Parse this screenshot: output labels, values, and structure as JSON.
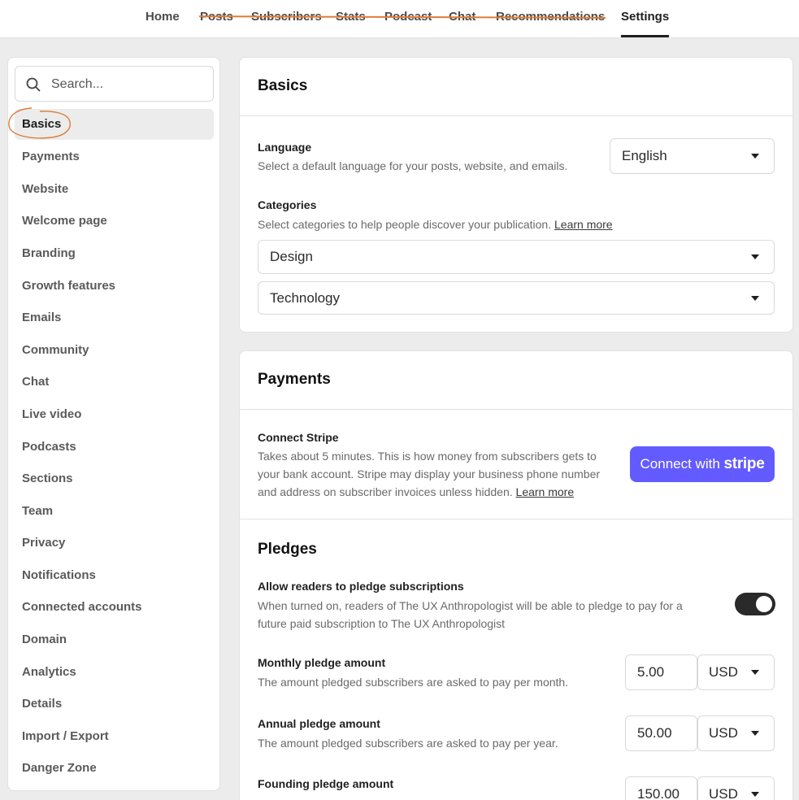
{
  "topnav": {
    "tabs": [
      {
        "label": "Home"
      },
      {
        "label": "Posts"
      },
      {
        "label": "Subscribers"
      },
      {
        "label": "Stats"
      },
      {
        "label": "Podcast"
      },
      {
        "label": "Chat"
      },
      {
        "label": "Recommendations"
      },
      {
        "label": "Settings"
      }
    ],
    "active": "Settings"
  },
  "sidebar": {
    "search_placeholder": "Search...",
    "items": [
      {
        "label": "Basics"
      },
      {
        "label": "Payments"
      },
      {
        "label": "Website"
      },
      {
        "label": "Welcome page"
      },
      {
        "label": "Branding"
      },
      {
        "label": "Growth features"
      },
      {
        "label": "Emails"
      },
      {
        "label": "Community"
      },
      {
        "label": "Chat"
      },
      {
        "label": "Live video"
      },
      {
        "label": "Podcasts"
      },
      {
        "label": "Sections"
      },
      {
        "label": "Team"
      },
      {
        "label": "Privacy"
      },
      {
        "label": "Notifications"
      },
      {
        "label": "Connected accounts"
      },
      {
        "label": "Domain"
      },
      {
        "label": "Analytics"
      },
      {
        "label": "Details"
      },
      {
        "label": "Import / Export"
      },
      {
        "label": "Danger Zone"
      }
    ]
  },
  "basics": {
    "title": "Basics",
    "language_label": "Language",
    "language_desc": "Select a default language for your posts, website, and emails.",
    "language_value": "English",
    "categories_label": "Categories",
    "categories_desc": "Select categories to help people discover your publication.",
    "learn_more": "Learn more",
    "category_1": "Design",
    "category_2": "Technology"
  },
  "payments": {
    "title": "Payments",
    "stripe_label": "Connect Stripe",
    "stripe_desc_1": "Takes about 5 minutes. This is how money from subscribers gets to",
    "stripe_desc_2": "your bank account. Stripe may display your business phone number",
    "stripe_desc_3": "and address on subscriber invoices unless hidden.",
    "learn_more": "Learn more",
    "stripe_button_prefix": "Connect with",
    "stripe_button_brand": "stripe",
    "pledges_title": "Pledges",
    "pledge_toggle_label": "Allow readers to pledge subscriptions",
    "pledge_toggle_desc_1": "When turned on, readers of The UX Anthropologist will be able to pledge to pay for a",
    "pledge_toggle_desc_2": "future paid subscription to The UX Anthropologist",
    "pledge_toggle_on": true,
    "monthly_label": "Monthly pledge amount",
    "monthly_desc": "The amount pledged subscribers are asked to pay per month.",
    "monthly_value": "5.00",
    "annual_label": "Annual pledge amount",
    "annual_desc": "The amount pledged subscribers are asked to pay per year.",
    "annual_value": "50.00",
    "founding_label": "Founding pledge amount",
    "founding_value": "150.00",
    "currency": "USD"
  },
  "colors": {
    "stripe_button": "#635bff",
    "annotation": "#e07a36"
  }
}
